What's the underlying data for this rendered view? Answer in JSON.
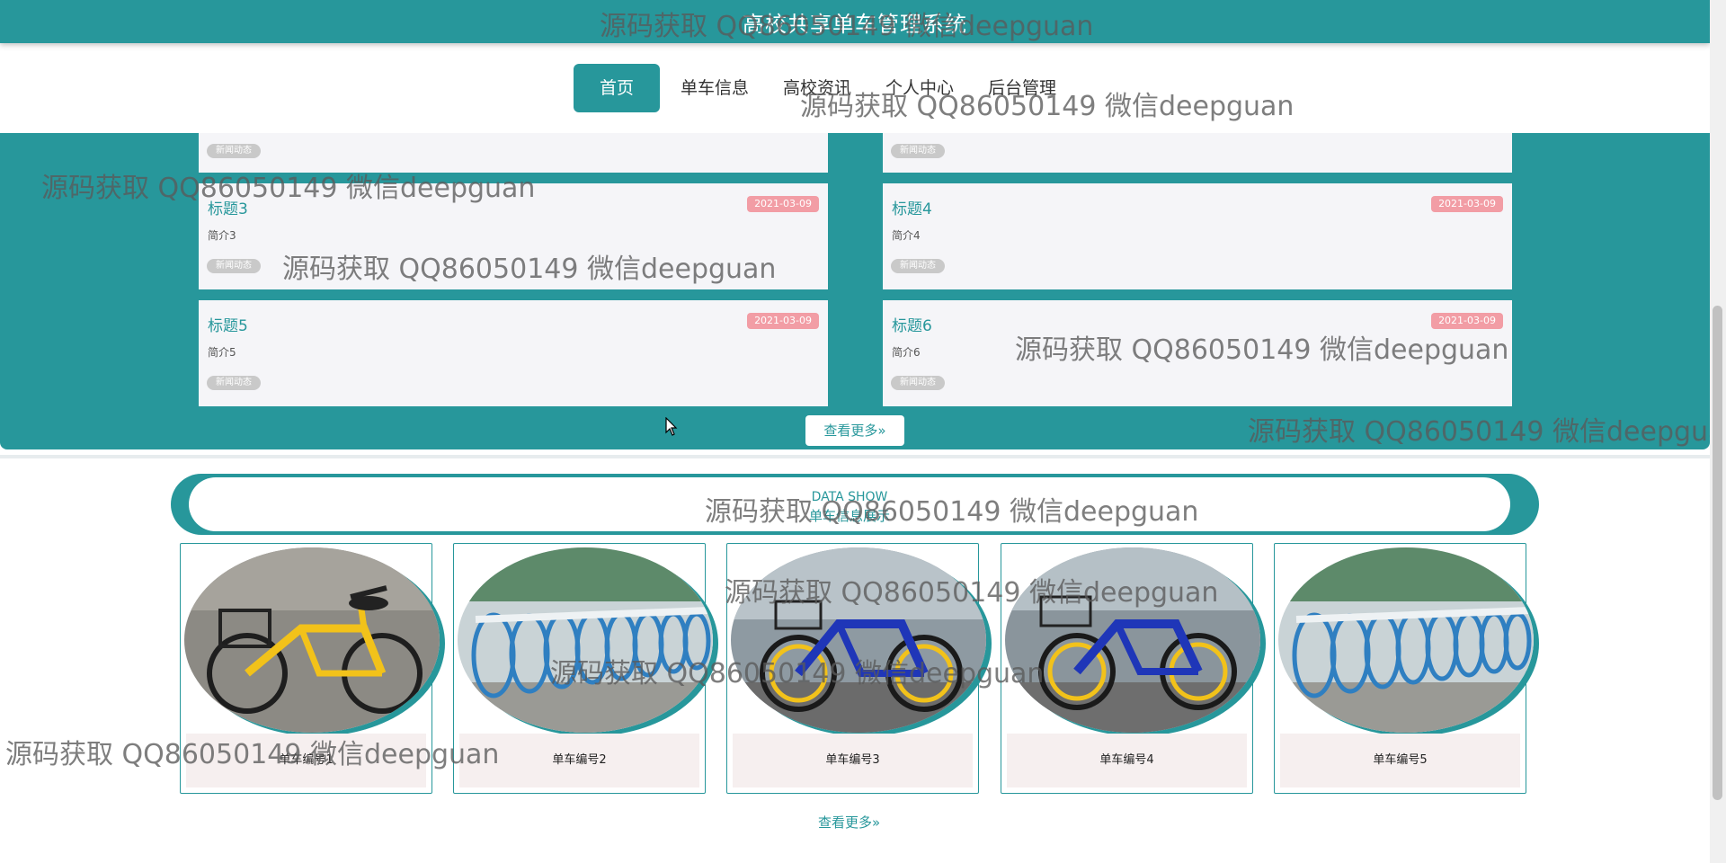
{
  "header": {
    "title": "高校共享单车管理系统"
  },
  "nav": {
    "items": [
      {
        "label": "首页",
        "active": true
      },
      {
        "label": "单车信息"
      },
      {
        "label": "高校资讯"
      },
      {
        "label": "个人中心"
      },
      {
        "label": "后台管理"
      }
    ]
  },
  "news": {
    "tag": "新闻动态",
    "items": [
      {
        "title": "标题3",
        "intro": "简介3",
        "date": "2021-03-09"
      },
      {
        "title": "标题4",
        "intro": "简介4",
        "date": "2021-03-09"
      },
      {
        "title": "标题5",
        "intro": "简介5",
        "date": "2021-03-09"
      },
      {
        "title": "标题6",
        "intro": "简介6",
        "date": "2021-03-09"
      }
    ],
    "more": "查看更多»"
  },
  "data_show": {
    "en": "DATA SHOW",
    "cn": "单车信息展示",
    "bikes": [
      {
        "name": "单车编号1",
        "image": "yellow-bike-photo"
      },
      {
        "name": "单车编号2",
        "image": "bike-row-photo"
      },
      {
        "name": "单车编号3",
        "image": "blue-bike-photo"
      },
      {
        "name": "单车编号4",
        "image": "blue-bike-photo"
      },
      {
        "name": "单车编号5",
        "image": "bike-row-photo"
      }
    ],
    "more": "查看更多»"
  },
  "watermark": "源码获取 QQ86050149 微信deepguan",
  "colors": {
    "primary": "#27979b",
    "date_badge": "#f29da5",
    "tag": "#c9c9c9"
  }
}
